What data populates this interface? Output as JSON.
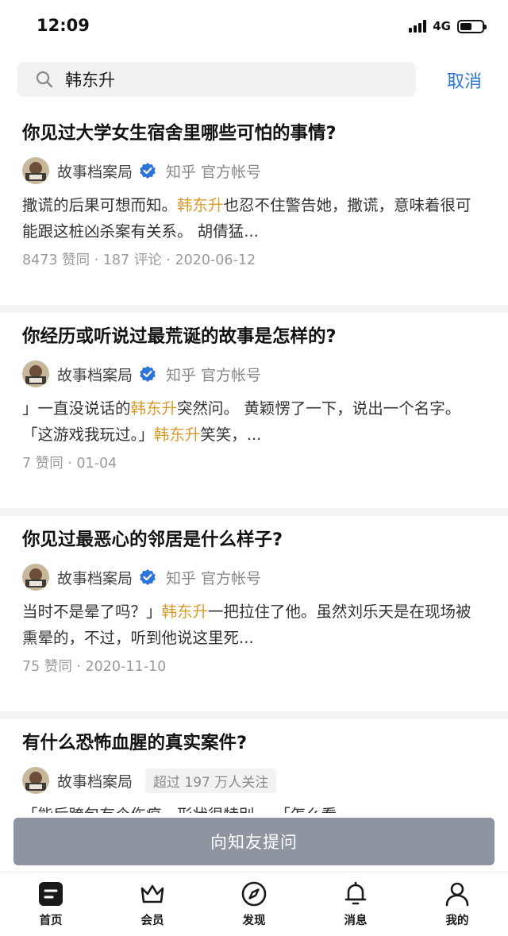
{
  "status_bar": {
    "time": "12:09",
    "network": "4G"
  },
  "search": {
    "query": "韩东升",
    "cancel_label": "取消"
  },
  "results": [
    {
      "title": "你见过大学女生宿舍里哪些可怕的事情?",
      "author": "故事档案局",
      "author_meta": "知乎 官方帐号",
      "verified": true,
      "excerpt_parts": [
        {
          "text": "撒谎的后果可想而知。",
          "hl": false
        },
        {
          "text": "韩东升",
          "hl": true
        },
        {
          "text": "也忍不住警告她，撒谎，意味着很可能跟这桩凶杀案有关系。 胡倩猛...",
          "hl": false
        }
      ],
      "stats": "8473 赞同 · 187 评论 · 2020-06-12"
    },
    {
      "title": "你经历或听说过最荒诞的故事是怎样的?",
      "author": "故事档案局",
      "author_meta": "知乎 官方帐号",
      "verified": true,
      "excerpt_parts": [
        {
          "text": "」一直没说话的",
          "hl": false
        },
        {
          "text": "韩东升",
          "hl": true
        },
        {
          "text": "突然问。 黄颖愣了一下，说出一个名字。 「这游戏我玩过。」",
          "hl": false
        },
        {
          "text": "韩东升",
          "hl": true
        },
        {
          "text": "笑笑，...",
          "hl": false
        }
      ],
      "stats": "7 赞同 · 01-04"
    },
    {
      "title": "你见过最恶心的邻居是什么样子?",
      "author": "故事档案局",
      "author_meta": "知乎 官方帐号",
      "verified": true,
      "excerpt_parts": [
        {
          "text": "当时不是晕了吗？」",
          "hl": false
        },
        {
          "text": "韩东升",
          "hl": true
        },
        {
          "text": "一把拉住了他。虽然刘乐天是在现场被熏晕的，不过，听到他说这里死...",
          "hl": false
        }
      ],
      "stats": "75 赞同 · 2020-11-10"
    },
    {
      "title": "有什么恐怖血腥的真实案件?",
      "author": "故事档案局",
      "author_meta": "",
      "verified": false,
      "follow_badge": "超过 197 万人关注",
      "excerpt_parts": [
        {
          "text": "「能后跨包有个伤痕，形状很特别。 「怎么看",
          "hl": false
        }
      ],
      "stats": ""
    }
  ],
  "ask_button_label": "向知友提问",
  "tabs": [
    {
      "label": "首页",
      "icon": "home-icon"
    },
    {
      "label": "会员",
      "icon": "crown-icon"
    },
    {
      "label": "发现",
      "icon": "compass-icon"
    },
    {
      "label": "消息",
      "icon": "bell-icon"
    },
    {
      "label": "我的",
      "icon": "person-icon"
    }
  ],
  "colors": {
    "highlight": "#d99a2b",
    "accent": "#2b74d9",
    "ask_button": "#8e95a1",
    "verified": "#2b74d9"
  }
}
